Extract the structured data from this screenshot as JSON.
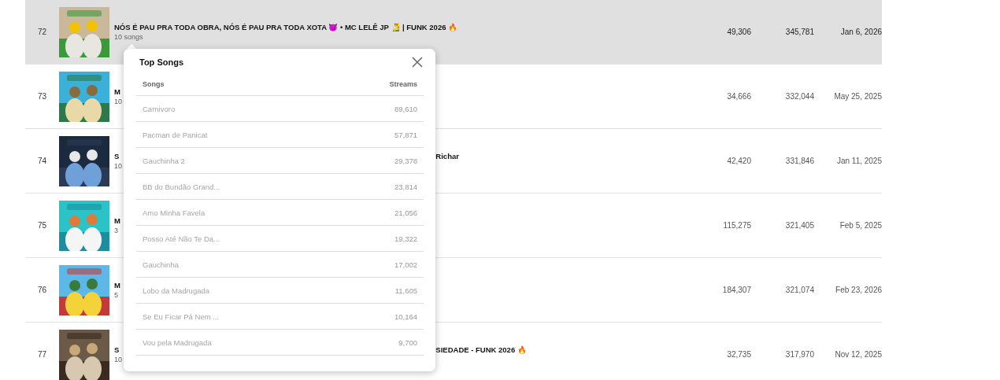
{
  "rows": [
    {
      "rank": "72",
      "title": "NÓS É PAU PRA TODA OBRA, NÓS É PAU PRA TODA XOTA 😈 • MC LELÊ JP 🧏‍♂️ | FUNK 2026 🔥",
      "count": "10 songs",
      "column_4": "49,306",
      "column_5": "345,781",
      "date": "Jan 6, 2026",
      "selected": true
    },
    {
      "rank": "73",
      "title": "M",
      "count": "10",
      "column_4": "34,666",
      "column_5": "332,044",
      "date": "May 25, 2025",
      "selected": false
    },
    {
      "rank": "74",
      "title": "S",
      "title_end": "Richar",
      "count": "10",
      "column_4": "42,420",
      "column_5": "331,846",
      "date": "Jan 11, 2025",
      "selected": false
    },
    {
      "rank": "75",
      "title": "M",
      "count": "3",
      "column_4": "115,275",
      "column_5": "321,405",
      "date": "Feb 5, 2025",
      "selected": false
    },
    {
      "rank": "76",
      "title": "M",
      "count": "5",
      "column_4": "184,307",
      "column_5": "321,074",
      "date": "Feb 23, 2026",
      "selected": false
    },
    {
      "rank": "77",
      "title": "S",
      "title_end": "SIEDADE - FUNK 2026 🔥",
      "count": "10",
      "column_4": "32,735",
      "column_5": "317,970",
      "date": "Nov 12, 2025",
      "selected": false
    }
  ],
  "popup": {
    "title": "Top Songs",
    "columns": [
      "Songs",
      "Streams"
    ],
    "songs": [
      {
        "name": "Carnivoro",
        "streams": "89,610"
      },
      {
        "name": "Pacman de Panicat",
        "streams": "57,871"
      },
      {
        "name": "Gauchinha 2",
        "streams": "29,378"
      },
      {
        "name": "BB do Bundão Grand...",
        "streams": "23,814"
      },
      {
        "name": "Amo Minha Favela",
        "streams": "21,056"
      },
      {
        "name": "Posso Até Não Te Da...",
        "streams": "19,322"
      },
      {
        "name": "Gauchinha",
        "streams": "17,002"
      },
      {
        "name": "Lobo da Madrugada",
        "streams": "11,605"
      },
      {
        "name": "Se Eu Ficar Pá Nem ...",
        "streams": "10,164"
      },
      {
        "name": "Vou pela Madrugada",
        "streams": "9,700"
      }
    ]
  }
}
